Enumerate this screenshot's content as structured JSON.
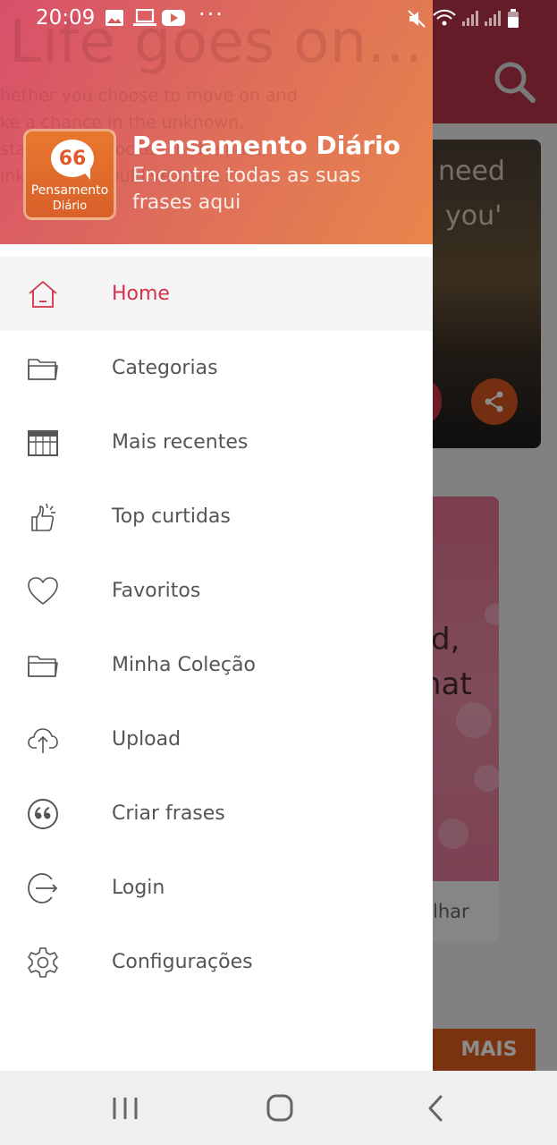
{
  "status_bar": {
    "time": "20:09"
  },
  "background": {
    "card1_lines": [
      "need",
      "you'"
    ],
    "card2_lines": [
      "d,",
      "hat"
    ],
    "card2_footer": "lhar",
    "more_button": "MAIS"
  },
  "drawer": {
    "header": {
      "ghost_title": "Life goes on...",
      "ghost_lines": [
        "hether you choose to move on and",
        "ke a chance in the unknown,",
        "stay behind, locked in the past,",
        "ink of what could've been..."
      ],
      "logo_text_line1": "Pensamento",
      "logo_text_line2": "Diário",
      "logo_mark": "66",
      "title": "Pensamento Diário",
      "subtitle": "Encontre todas as suas frases aqui"
    },
    "menu": [
      {
        "label": "Home",
        "icon": "home-icon",
        "active": true
      },
      {
        "label": "Categorias",
        "icon": "folder-icon"
      },
      {
        "label": "Mais recentes",
        "icon": "calendar-icon"
      },
      {
        "label": "Top curtidas",
        "icon": "thumbs-up-icon"
      },
      {
        "label": "Favoritos",
        "icon": "heart-icon"
      },
      {
        "label": "Minha Coleção",
        "icon": "folder-open-icon"
      },
      {
        "label": "Upload",
        "icon": "cloud-upload-icon"
      },
      {
        "label": "Criar frases",
        "icon": "quote-icon"
      },
      {
        "label": "Login",
        "icon": "login-icon"
      },
      {
        "label": "Configurações",
        "icon": "settings-icon"
      }
    ]
  },
  "colors": {
    "accent": "#d6304a",
    "header_start": "#d8506b",
    "header_end": "#e8874c",
    "menu_text": "#555555"
  }
}
